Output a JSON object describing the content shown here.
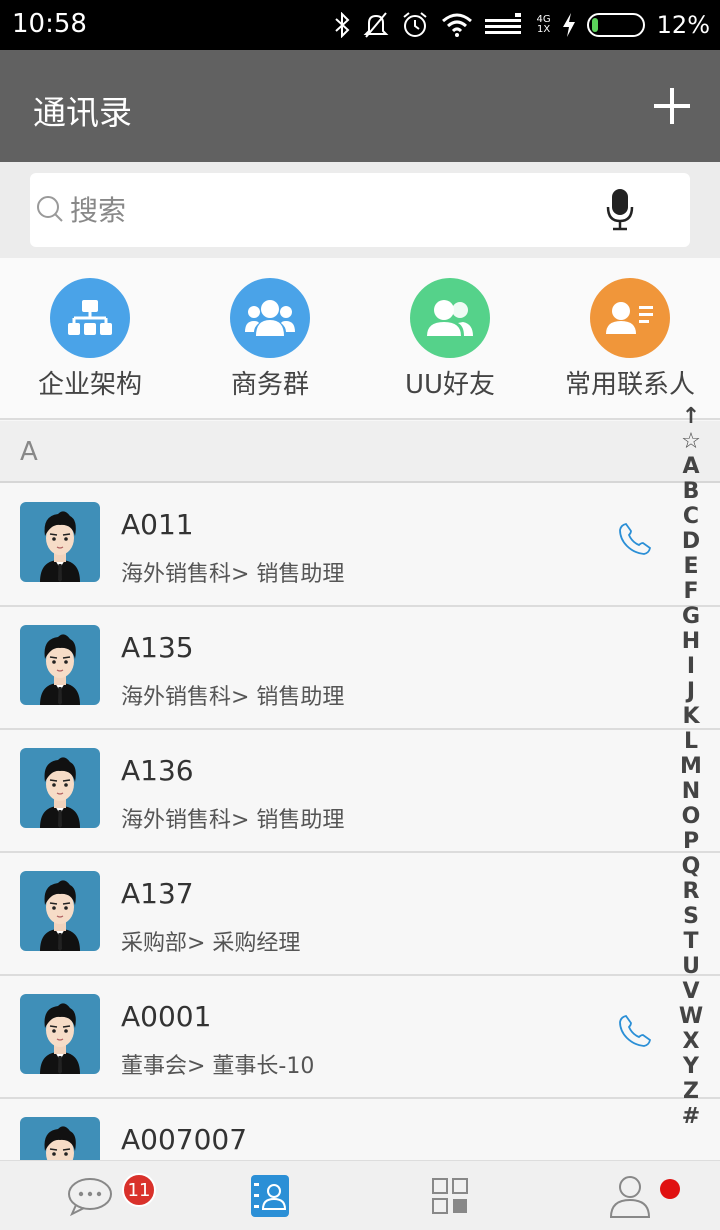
{
  "status_bar": {
    "time": "10:58",
    "network": [
      "4G",
      "1X"
    ],
    "battery": "12%",
    "battery_level": 0.12
  },
  "header": {
    "title": "通讯录"
  },
  "search": {
    "placeholder": "搜索"
  },
  "quick_access": [
    {
      "label": "企业架构",
      "color": "#4aa3e8",
      "icon": "org-chart-icon"
    },
    {
      "label": "商务群",
      "color": "#4aa3e8",
      "icon": "group-icon"
    },
    {
      "label": "UU好友",
      "color": "#55d28a",
      "icon": "friends-icon"
    },
    {
      "label": "常用联系人",
      "color": "#f0963a",
      "icon": "contact-card-icon"
    }
  ],
  "section": {
    "letter": "A"
  },
  "contacts": [
    {
      "name": "A011",
      "dept": "海外销售科> 销售助理",
      "phone": true
    },
    {
      "name": "A135",
      "dept": "海外销售科> 销售助理",
      "phone": false
    },
    {
      "name": "A136",
      "dept": "海外销售科> 销售助理",
      "phone": false
    },
    {
      "name": "A137",
      "dept": "采购部> 采购经理",
      "phone": false
    },
    {
      "name": "A0001",
      "dept": "董事会> 董事长-10",
      "phone": true
    },
    {
      "name": "A007007",
      "dept": "",
      "phone": false
    }
  ],
  "alphabet_index": [
    "↑",
    "☆",
    "A",
    "B",
    "C",
    "D",
    "E",
    "F",
    "G",
    "H",
    "I",
    "J",
    "K",
    "L",
    "M",
    "N",
    "O",
    "P",
    "Q",
    "R",
    "S",
    "T",
    "U",
    "V",
    "W",
    "X",
    "Y",
    "Z",
    "#"
  ],
  "bottom_nav": {
    "items": [
      "chat-bubble-icon",
      "contacts-book-icon",
      "apps-grid-icon",
      "profile-icon"
    ],
    "messages_badge": "11",
    "accent_color": "#2b8fd6"
  }
}
